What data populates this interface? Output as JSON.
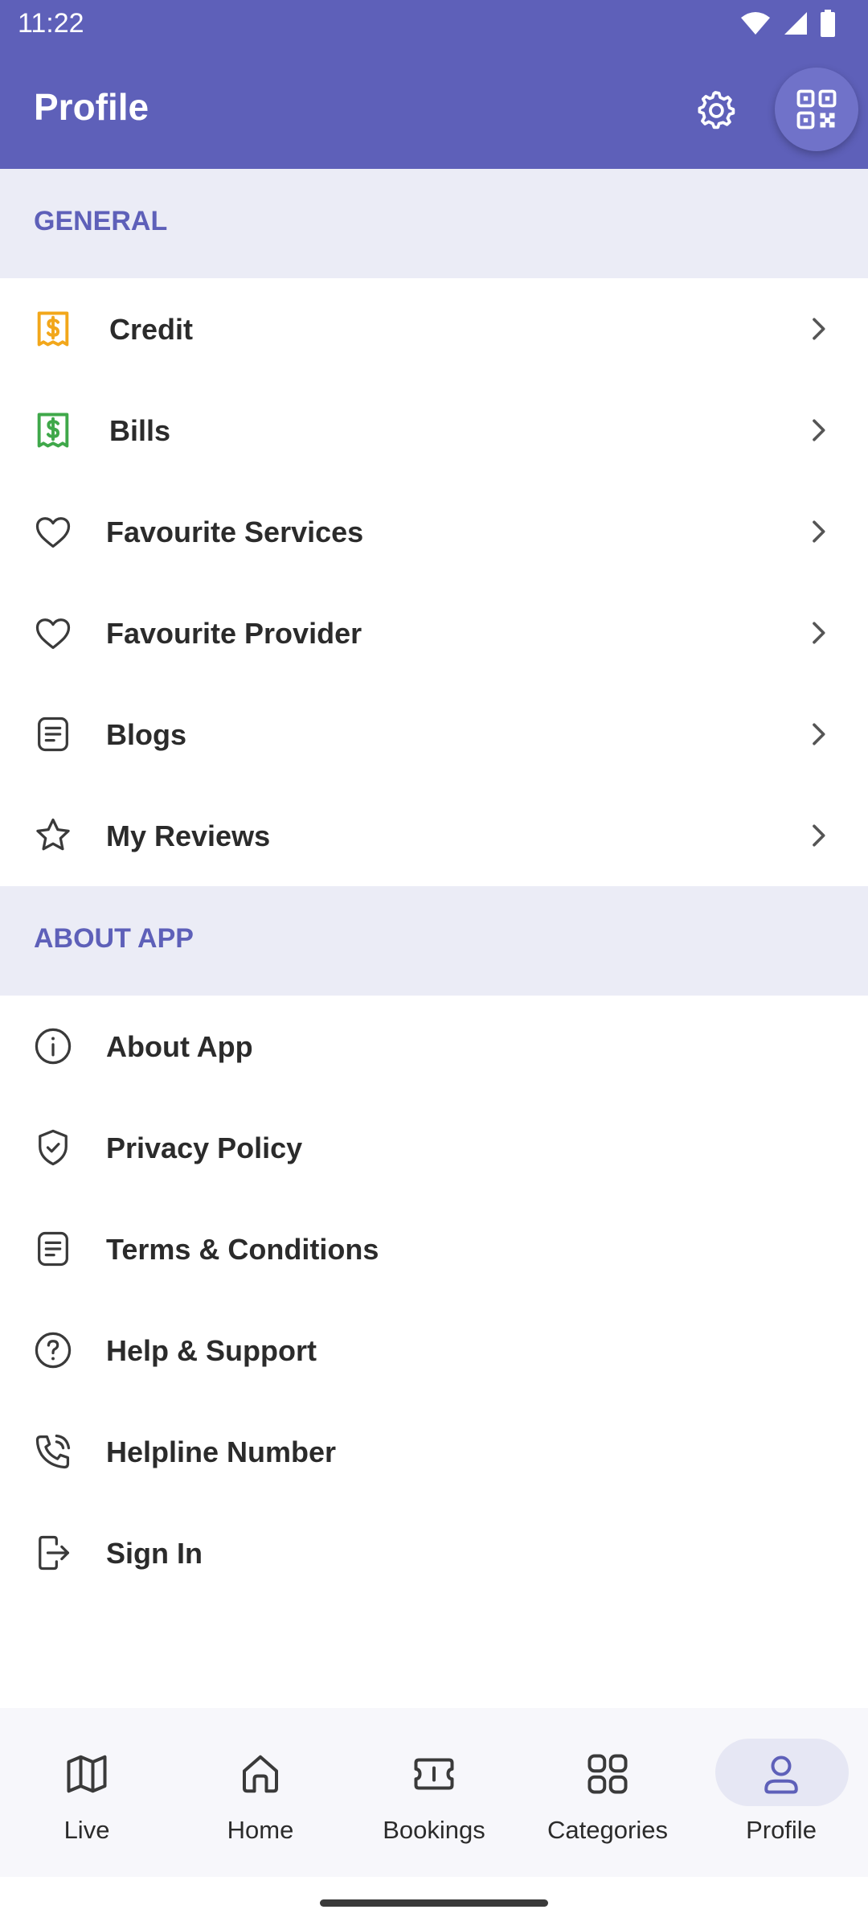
{
  "status_bar": {
    "time": "11:22"
  },
  "app_bar": {
    "title": "Profile"
  },
  "general": {
    "header": "GENERAL",
    "items": [
      {
        "label": "Credit",
        "icon": "receipt-dollar-icon"
      },
      {
        "label": "Bills",
        "icon": "receipt-dollar-icon"
      },
      {
        "label": "Favourite Services",
        "icon": "heart-icon"
      },
      {
        "label": "Favourite Provider",
        "icon": "heart-icon"
      },
      {
        "label": "Blogs",
        "icon": "document-icon"
      },
      {
        "label": "My Reviews",
        "icon": "star-icon"
      }
    ]
  },
  "about": {
    "header": "ABOUT APP",
    "items": [
      {
        "label": "About App",
        "icon": "info-icon"
      },
      {
        "label": "Privacy Policy",
        "icon": "shield-check-icon"
      },
      {
        "label": "Terms & Conditions",
        "icon": "document-icon"
      },
      {
        "label": "Help & Support",
        "icon": "help-circle-icon"
      },
      {
        "label": "Helpline Number",
        "icon": "phone-call-icon"
      },
      {
        "label": "Sign In",
        "icon": "login-icon"
      }
    ]
  },
  "bottom_nav": {
    "items": [
      {
        "label": "Live",
        "icon": "map-icon"
      },
      {
        "label": "Home",
        "icon": "home-icon"
      },
      {
        "label": "Bookings",
        "icon": "ticket-icon"
      },
      {
        "label": "Categories",
        "icon": "grid-icon"
      },
      {
        "label": "Profile",
        "icon": "user-icon"
      }
    ],
    "active": "Profile"
  },
  "colors": {
    "primary": "#5e60b9",
    "section_bg": "#ebecf6",
    "credit_icon": "#f2a71b",
    "bills_icon": "#3fa84a"
  }
}
